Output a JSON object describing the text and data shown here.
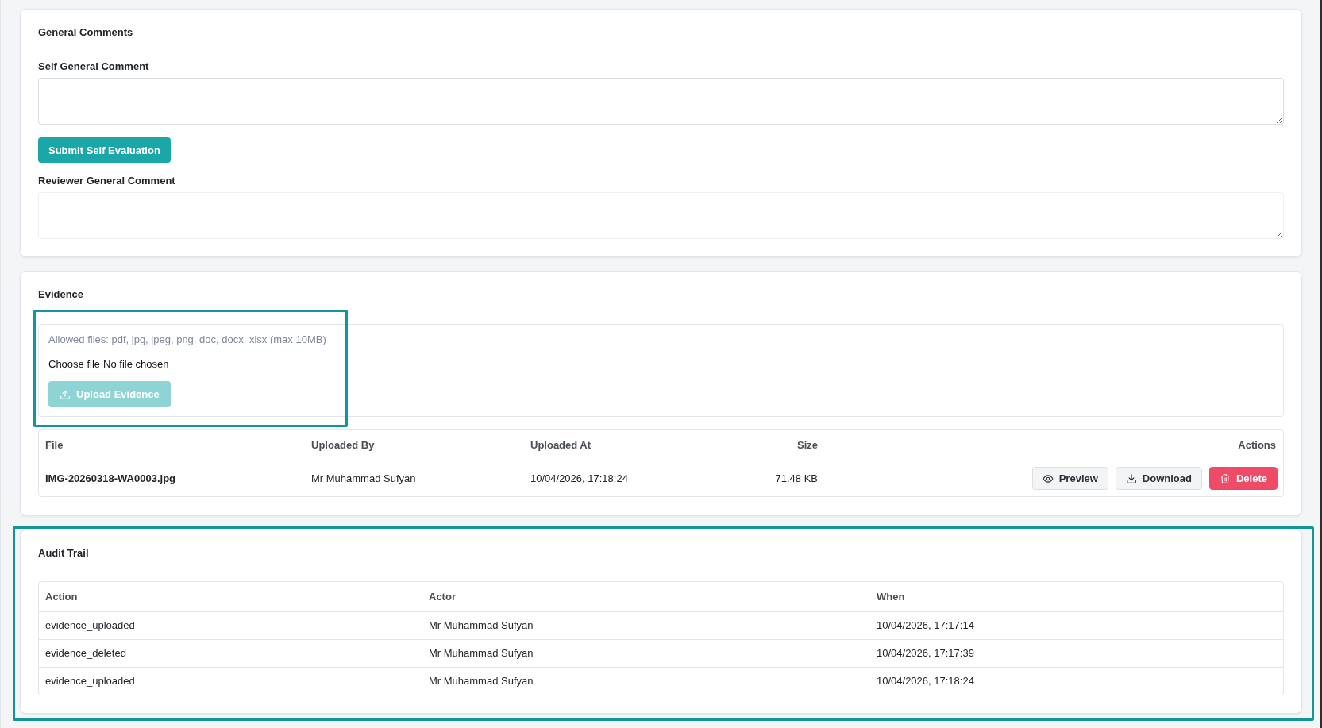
{
  "general_comments": {
    "title": "General Comments",
    "self_comment": {
      "label": "Self General Comment",
      "readonly": false
    },
    "submit_button": {
      "label": "Submit Self Evaluation",
      "disabled": false
    },
    "reviewer_comment": {
      "label": "Reviewer General Comment",
      "readonly": true
    }
  },
  "evidence": {
    "title": "Evidence",
    "upload_panel": {
      "highlighted": true,
      "hint": "Allowed files: pdf, jpg, jpeg, png, doc, docx, xlsx (max 10MB)",
      "file_input": {
        "button": "Choose file",
        "status": "No file chosen"
      },
      "upload_button": {
        "label": "Upload Evidence",
        "disabled": true
      }
    },
    "table": {
      "columns": [
        "File",
        "Uploaded By",
        "Uploaded At",
        "Size",
        "Actions"
      ],
      "rows": [
        {
          "cells": [
            "IMG-20260318-WA0003.jpg",
            "Mr Muhammad Sufyan",
            "10/04/2026, 17:18:24",
            "71.48 KB"
          ],
          "actions": [
            {
              "kind": "preview",
              "label": "Preview"
            },
            {
              "kind": "download",
              "label": "Download"
            },
            {
              "kind": "delete",
              "label": "Delete"
            }
          ]
        }
      ]
    }
  },
  "audit_trail": {
    "title": "Audit Trail",
    "highlighted": true,
    "table": {
      "columns": [
        "Action",
        "Actor",
        "When"
      ],
      "rows": [
        [
          "evidence_uploaded",
          "Mr Muhammad Sufyan",
          "10/04/2026, 17:17:14"
        ],
        [
          "evidence_deleted",
          "Mr Muhammad Sufyan",
          "10/04/2026, 17:17:39"
        ],
        [
          "evidence_uploaded",
          "Mr Muhammad Sufyan",
          "10/04/2026, 17:18:24"
        ]
      ]
    }
  }
}
